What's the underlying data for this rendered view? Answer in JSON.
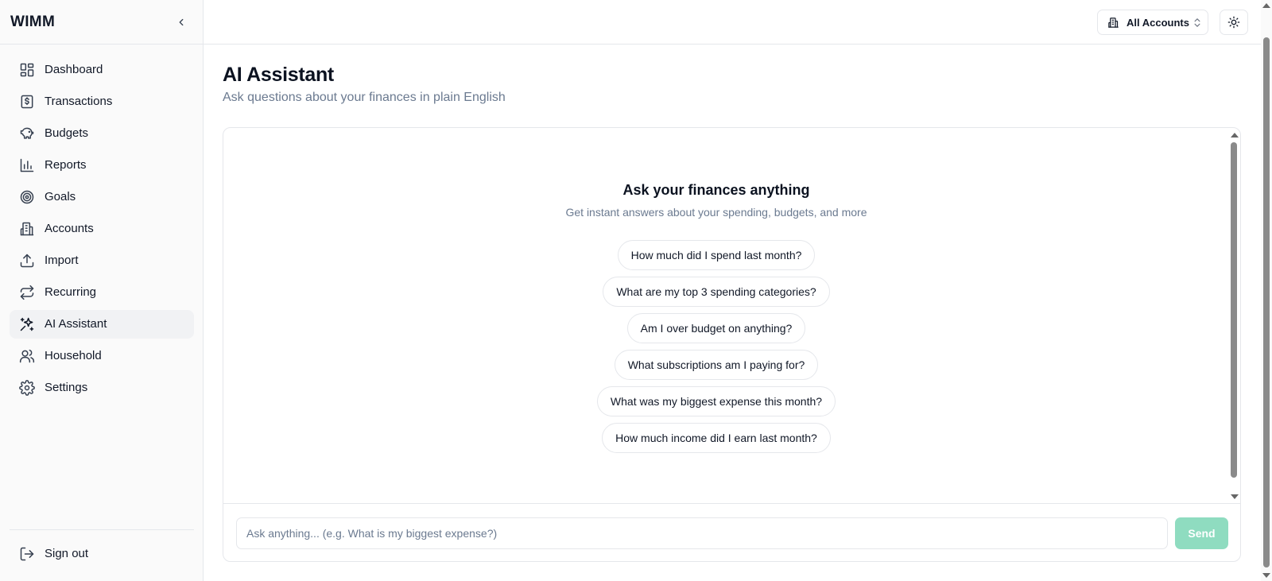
{
  "app": {
    "brand": "WIMM"
  },
  "sidebar": {
    "items": [
      {
        "label": "Dashboard",
        "icon": "dashboard-icon",
        "active": false
      },
      {
        "label": "Transactions",
        "icon": "dollar-receipt-icon",
        "active": false
      },
      {
        "label": "Budgets",
        "icon": "piggy-bank-icon",
        "active": false
      },
      {
        "label": "Reports",
        "icon": "bar-chart-icon",
        "active": false
      },
      {
        "label": "Goals",
        "icon": "target-icon",
        "active": false
      },
      {
        "label": "Accounts",
        "icon": "building-icon",
        "active": false
      },
      {
        "label": "Import",
        "icon": "upload-icon",
        "active": false
      },
      {
        "label": "Recurring",
        "icon": "repeat-icon",
        "active": false
      },
      {
        "label": "AI Assistant",
        "icon": "sparkles-icon",
        "active": true
      },
      {
        "label": "Household",
        "icon": "users-icon",
        "active": false
      },
      {
        "label": "Settings",
        "icon": "gear-icon",
        "active": false
      }
    ],
    "signout_label": "Sign out"
  },
  "header": {
    "account_selector": "All Accounts"
  },
  "page": {
    "title": "AI Assistant",
    "subtitle": "Ask questions about your finances in plain English"
  },
  "chat": {
    "empty_title": "Ask your finances anything",
    "empty_subtitle": "Get instant answers about your spending, budgets, and more",
    "suggestions": [
      "How much did I spend last month?",
      "What are my top 3 spending categories?",
      "Am I over budget on anything?",
      "What subscriptions am I paying for?",
      "What was my biggest expense this month?",
      "How much income did I earn last month?"
    ],
    "input_placeholder": "Ask anything... (e.g. What is my biggest expense?)",
    "input_value": "",
    "send_label": "Send"
  },
  "colors": {
    "accent": "#8fdcc0",
    "active_nav_bg": "#f1f2f4",
    "muted_text": "#6b7a90"
  }
}
